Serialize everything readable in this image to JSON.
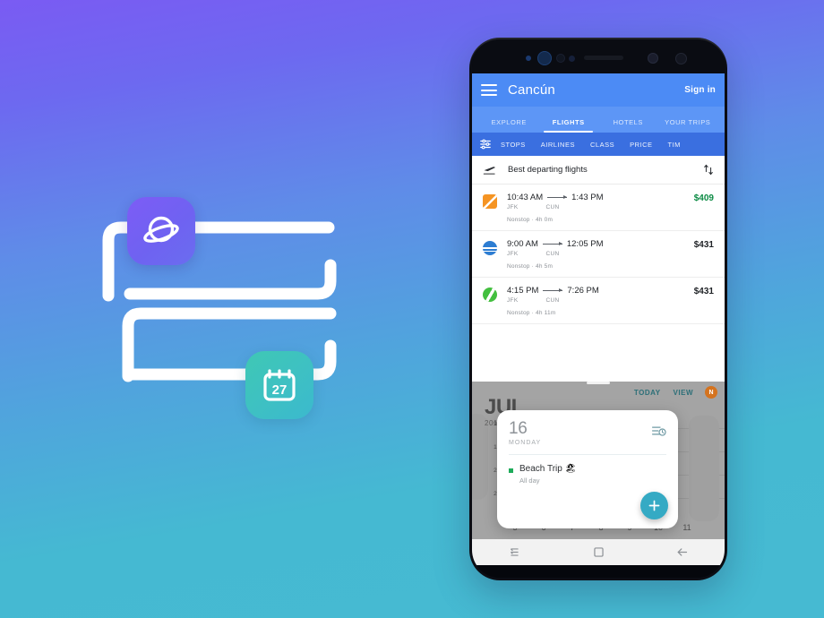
{
  "background": {
    "gradient_top": "#7a5bf3",
    "gradient_bottom": "#46bad2"
  },
  "illustration": {
    "name": "routing-path-illustration",
    "path_color": "#ffffff",
    "browser_tile": {
      "icon": "planet-browser-icon",
      "color_start": "#7d5cf6",
      "color_end": "#6a6df0"
    },
    "calendar_tile": {
      "icon": "calendar-icon",
      "day_label": "27",
      "color_start": "#3fc8b4",
      "color_end": "#3bb9ce"
    }
  },
  "phone": {
    "frame_color": "#0b0d14",
    "navbar": {
      "recents_label": "recents-icon",
      "home_label": "home-icon",
      "back_label": "back-icon"
    }
  },
  "flights_app": {
    "appbar": {
      "menu_icon": "hamburger-icon",
      "title": "Cancún",
      "sign_in_label": "Sign in",
      "bg_color": "#4c8bf5"
    },
    "tabs": [
      {
        "label": "EXPLORE",
        "active": false
      },
      {
        "label": "FLIGHTS",
        "active": true
      },
      {
        "label": "HOTELS",
        "active": false
      },
      {
        "label": "YOUR TRIPS",
        "active": false
      }
    ],
    "filters": {
      "tune_icon": "tune-icon",
      "chips": [
        "STOPS",
        "AIRLINES",
        "CLASS",
        "PRICE",
        "TIM"
      ]
    },
    "section": {
      "icon": "flight-takeoff-icon",
      "title": "Best departing flights",
      "sort_icon": "sort-arrows-icon"
    },
    "flights": [
      {
        "logo": "airline-logo-orange-square",
        "logo_color": "#f59423",
        "depart_time": "10:43 AM",
        "arrive_time": "1:43 PM",
        "from": "JFK",
        "to": "CUN",
        "stops": "Nonstop",
        "duration": "4h 0m",
        "meta_separator": "·",
        "price": "$409",
        "price_color": "#0a8a43"
      },
      {
        "logo": "airline-logo-blue-circle",
        "logo_color": "#2d7dd2",
        "depart_time": "9:00 AM",
        "arrive_time": "12:05 PM",
        "from": "JFK",
        "to": "CUN",
        "stops": "Nonstop",
        "duration": "4h 5m",
        "meta_separator": "·",
        "price": "$431",
        "price_color": "#1f2226"
      },
      {
        "logo": "airline-logo-green-circle",
        "logo_color": "#43bf3f",
        "depart_time": "4:15 PM",
        "arrive_time": "7:26 PM",
        "from": "JFK",
        "to": "CUN",
        "stops": "Nonstop",
        "duration": "4h 11m",
        "meta_separator": "·",
        "price": "$431",
        "price_color": "#1f2226"
      }
    ]
  },
  "calendar_app": {
    "month": "JUL",
    "year": "201",
    "today_label": "TODAY",
    "view_label": "VIEW",
    "avatar_initial": "N",
    "avatar_color": "#d4731f",
    "hour_labels": [
      "9",
      "1",
      "2",
      "2"
    ],
    "day_numbers": [
      "5",
      "6",
      "7",
      "8",
      "9",
      "10",
      "11"
    ],
    "event_card": {
      "day_number": "16",
      "weekday": "MONDAY",
      "agenda_icon": "agenda-clock-icon",
      "event_title": "Beach Trip",
      "event_emoji": "🏖",
      "event_time": "All day",
      "event_dot_color": "#1eab5a",
      "fab_icon": "plus-icon",
      "fab_color": "#35aac4"
    }
  }
}
